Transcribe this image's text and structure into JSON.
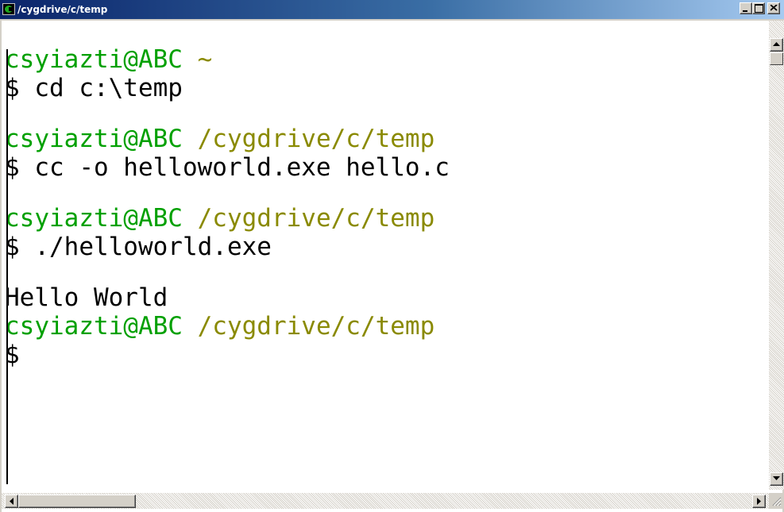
{
  "window": {
    "title": "/cygdrive/c/temp",
    "icon": "cygwin-icon",
    "controls": {
      "minimize_icon": "minimize-icon",
      "maximize_icon": "maximize-icon",
      "close_icon": "close-icon"
    }
  },
  "terminal": {
    "colors": {
      "userhost": "#00a000",
      "path": "#8a8a00",
      "text": "#000000",
      "background": "#ffffff"
    },
    "session": [
      {
        "type": "prompt",
        "userhost": "csyiazti@ABC",
        "path": "~"
      },
      {
        "type": "command",
        "text": "$ cd c:\\temp"
      },
      {
        "type": "prompt",
        "userhost": "csyiazti@ABC",
        "path": "/cygdrive/c/temp"
      },
      {
        "type": "command",
        "text": "$ cc -o helloworld.exe hello.c"
      },
      {
        "type": "prompt",
        "userhost": "csyiazti@ABC",
        "path": "/cygdrive/c/temp"
      },
      {
        "type": "command",
        "text": "$ ./helloworld.exe"
      },
      {
        "type": "output",
        "text": "Hello World"
      },
      {
        "type": "prompt",
        "userhost": "csyiazti@ABC",
        "path": "/cygdrive/c/temp"
      },
      {
        "type": "command",
        "text": "$"
      }
    ]
  },
  "scrollbars": {
    "vertical": {
      "up_icon": "arrow-up-icon",
      "down_icon": "arrow-down-icon"
    },
    "horizontal": {
      "left_icon": "arrow-left-icon",
      "right_icon": "arrow-right-icon"
    },
    "resize_icon": "resize-grip-icon"
  }
}
